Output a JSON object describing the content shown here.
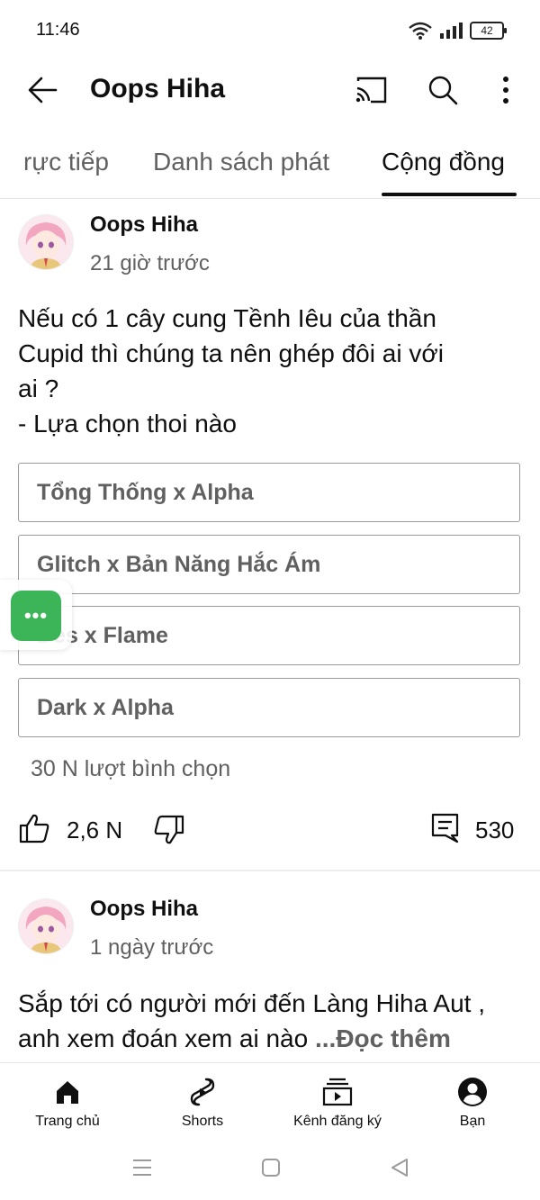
{
  "status_bar": {
    "time": "11:46",
    "battery": "42"
  },
  "header": {
    "title": "Oops Hiha"
  },
  "tabs": [
    {
      "label": "rực tiếp"
    },
    {
      "label": "Danh sách phát"
    },
    {
      "label": "Cộng đồng"
    }
  ],
  "posts": [
    {
      "author": "Oops Hiha",
      "time": "21 giờ trước",
      "text_lines": [
        "Nếu có 1 cây cung Tềnh Iêu của thần",
        "Cupid thì chúng ta nên ghép đôi ai với",
        "ai ?",
        "- Lựa chọn thoi nào"
      ],
      "poll": [
        {
          "label": "Tổng Thống x Alpha"
        },
        {
          "label": "Glitch x  Bản Năng Hắc Ám"
        },
        {
          "label": "Des x Flame"
        },
        {
          "label": "Dark x Alpha"
        }
      ],
      "votes": "30 N lượt bình chọn",
      "likes": "2,6 N",
      "comments": "530"
    },
    {
      "author": "Oops Hiha",
      "time": "1 ngày trước",
      "text_lines": [
        "Sắp tới có người mới đến Làng Hiha Aut ,",
        "anh xem đoán xem ai nào "
      ],
      "read_more": "...Đọc thêm"
    }
  ],
  "floating_button": {
    "label": "•••"
  },
  "bottom_nav": [
    {
      "label": "Trang chủ",
      "icon": "home-icon"
    },
    {
      "label": "Shorts",
      "icon": "shorts-icon"
    },
    {
      "label": "Kênh đăng ký",
      "icon": "subscriptions-icon"
    },
    {
      "label": "Bạn",
      "icon": "account-icon"
    }
  ],
  "colors": {
    "accent_text": "#0f0f0f",
    "secondary_text": "#606060",
    "fab": "#3bb558",
    "avatar_pink": "#f3b6c8"
  }
}
